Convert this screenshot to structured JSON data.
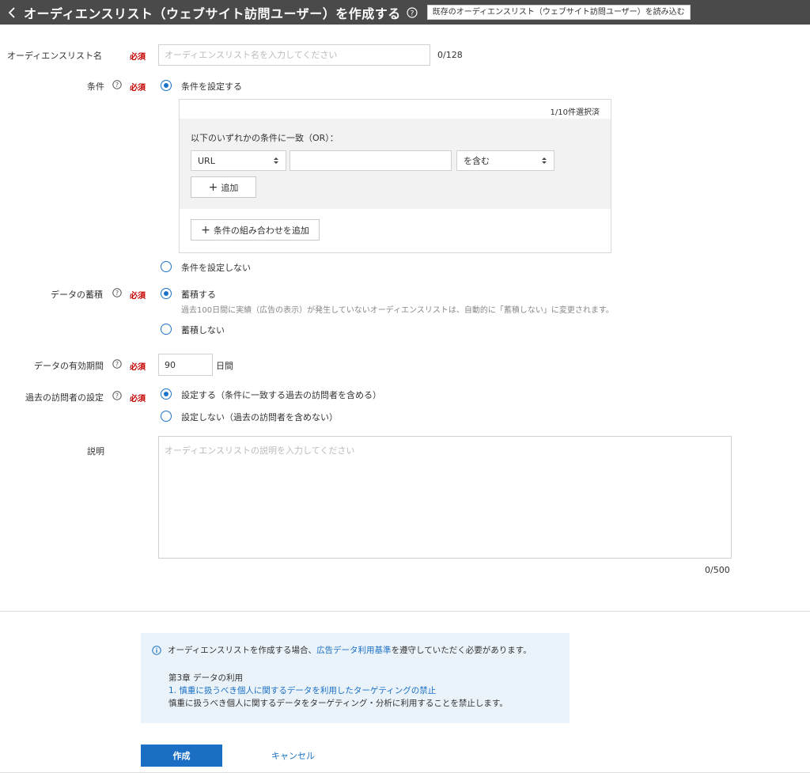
{
  "header": {
    "title": "オーディエンスリスト（ウェブサイト訪問ユーザー）を作成する",
    "load_button": "既存のオーディエンスリスト（ウェブサイト訪問ユーザー）を読み込む"
  },
  "required_label": "必須",
  "name_field": {
    "label": "オーディエンスリスト名",
    "placeholder": "オーディエンスリスト名を入力してください",
    "value": "",
    "counter": "0/128"
  },
  "conditions": {
    "label": "条件",
    "option_set": "条件を設定する",
    "option_none": "条件を設定しない",
    "selected_count": "1/10件選択済",
    "group_title": "以下のいずれかの条件に一致（OR）：",
    "field_select": "URL",
    "value_input": "",
    "operator_select": "を含む",
    "add_button": "追加",
    "add_combination_button": "条件の組み合わせを追加"
  },
  "accumulation": {
    "label": "データの蓄積",
    "option_on": "蓄積する",
    "note": "過去100日間に実績（広告の表示）が発生していないオーディエンスリストは、自動的に「蓄積しない」に変更されます。",
    "option_off": "蓄積しない"
  },
  "validity": {
    "label": "データの有効期間",
    "value": "90",
    "unit": "日間"
  },
  "past_visitors": {
    "label": "過去の訪問者の設定",
    "option_on": "設定する（条件に一致する過去の訪問者を含める）",
    "option_off": "設定しない（過去の訪問者を含めない）"
  },
  "description": {
    "label": "説明",
    "placeholder": "オーディエンスリストの説明を入力してください",
    "counter": "0/500"
  },
  "notice": {
    "text_before": "オーディエンスリストを作成する場合、",
    "link": "広告データ利用基準",
    "text_after": "を遵守していただく必要があります。",
    "chapter": "第3章 データの利用",
    "rule_link": "1. 慎重に扱うべき個人に関するデータを利用したターゲティングの禁止",
    "rule_text": "慎重に扱うべき個人に関するデータをターゲティング・分析に利用することを禁止します。"
  },
  "actions": {
    "create": "作成",
    "cancel": "キャンセル"
  }
}
